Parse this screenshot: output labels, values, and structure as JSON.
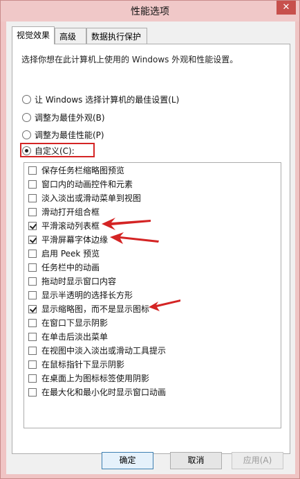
{
  "window": {
    "title": "性能选项",
    "close_label": "✕"
  },
  "tabs": [
    {
      "label": "视觉效果",
      "active": true
    },
    {
      "label": "高级",
      "active": false
    },
    {
      "label": "数据执行保护",
      "active": false
    }
  ],
  "visual_effects": {
    "description": "选择你想在此计算机上使用的 Windows 外观和性能设置。",
    "radios": [
      {
        "label": "让 Windows 选择计算机的最佳设置(L)",
        "checked": false
      },
      {
        "label": "调整为最佳外观(B)",
        "checked": false
      },
      {
        "label": "调整为最佳性能(P)",
        "checked": false
      },
      {
        "label": "自定义(C):",
        "checked": true
      }
    ],
    "effects": [
      {
        "label": "保存任务栏缩略图预览",
        "checked": false
      },
      {
        "label": "窗口内的动画控件和元素",
        "checked": false
      },
      {
        "label": "淡入淡出或滑动菜单到视图",
        "checked": false
      },
      {
        "label": "滑动打开组合框",
        "checked": false
      },
      {
        "label": "平滑滚动列表框",
        "checked": true
      },
      {
        "label": "平滑屏幕字体边缘",
        "checked": true
      },
      {
        "label": "启用 Peek 预览",
        "checked": false
      },
      {
        "label": "任务栏中的动画",
        "checked": false
      },
      {
        "label": "拖动时显示窗口内容",
        "checked": false
      },
      {
        "label": "显示半透明的选择长方形",
        "checked": false
      },
      {
        "label": "显示缩略图，而不是显示图标",
        "checked": true
      },
      {
        "label": "在窗口下显示阴影",
        "checked": false
      },
      {
        "label": "在单击后淡出菜单",
        "checked": false
      },
      {
        "label": "在视图中淡入淡出或滑动工具提示",
        "checked": false
      },
      {
        "label": "在鼠标指针下显示阴影",
        "checked": false
      },
      {
        "label": "在桌面上为图标标签使用阴影",
        "checked": false
      },
      {
        "label": "在最大化和最小化时显示窗口动画",
        "checked": false
      }
    ]
  },
  "buttons": {
    "ok": "确定",
    "cancel": "取消",
    "apply": "应用(A)"
  },
  "annotation_color": "#d42424"
}
